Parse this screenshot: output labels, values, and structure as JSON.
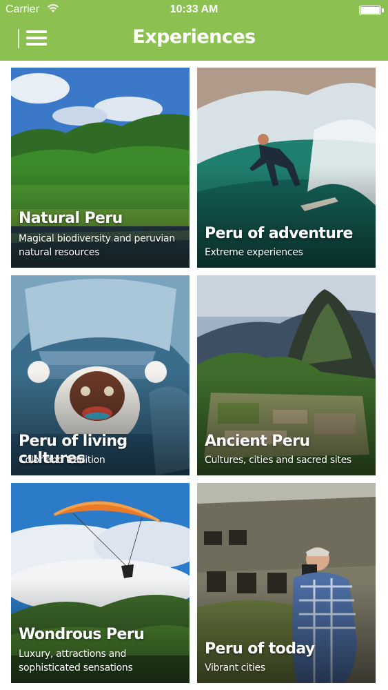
{
  "status_bar": {
    "carrier": "Carrier",
    "time": "10:33 AM"
  },
  "header": {
    "title": "Experiences"
  },
  "colors": {
    "header": "#8cc152",
    "text": "#ffffff"
  },
  "cards": [
    {
      "title": "Natural Peru",
      "subtitle": "Magical biodiversity and peruvian natural resources"
    },
    {
      "title": "Peru of adventure",
      "subtitle": "Extreme experiences"
    },
    {
      "title": "Peru of living cultures",
      "subtitle": "Color and tradition"
    },
    {
      "title": "Ancient Peru",
      "subtitle": "Cultures, cities and sacred sites"
    },
    {
      "title": "Wondrous Peru",
      "subtitle": "Luxury, attractions and sophisticated sensations"
    },
    {
      "title": "Peru of today",
      "subtitle": "Vibrant cities"
    }
  ]
}
